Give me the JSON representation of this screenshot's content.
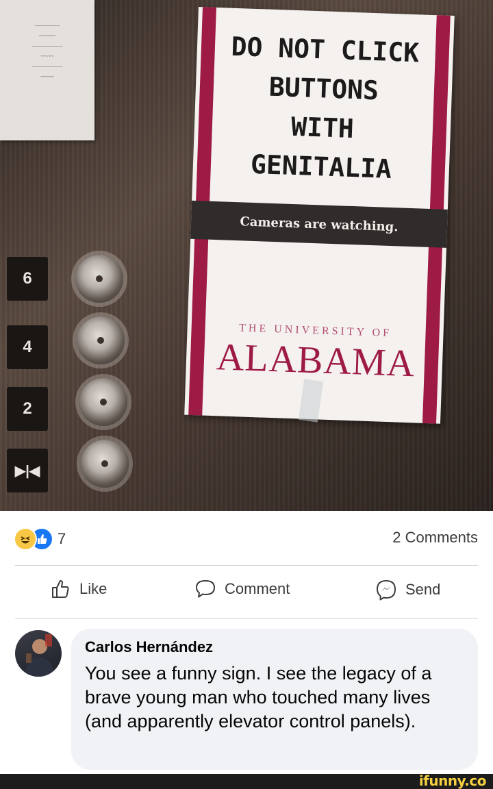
{
  "photo": {
    "sign": {
      "headline_lines": [
        "DO NOT CLICK",
        "BUTTONS",
        "WITH",
        "GENITALIA"
      ],
      "cameras_text": "Cameras are watching.",
      "university_small": "THE UNIVERSITY OF",
      "university_big": "ALABAMA",
      "accent_color": "#9e1b45"
    },
    "floor_labels": [
      "6",
      "4",
      "2",
      "▶|◀"
    ]
  },
  "reactions": {
    "icons": [
      "haha-emoji-icon",
      "like-thumb-icon"
    ],
    "count": "7"
  },
  "comments_count": "2 Comments",
  "actions": {
    "like_label": "Like",
    "comment_label": "Comment",
    "send_label": "Send"
  },
  "comment": {
    "author": "Carlos Hernández",
    "text": "You see a funny sign. I see the legacy of a brave young man who touched many lives (and apparently elevator control panels)."
  },
  "watermark": "ifunny.co"
}
